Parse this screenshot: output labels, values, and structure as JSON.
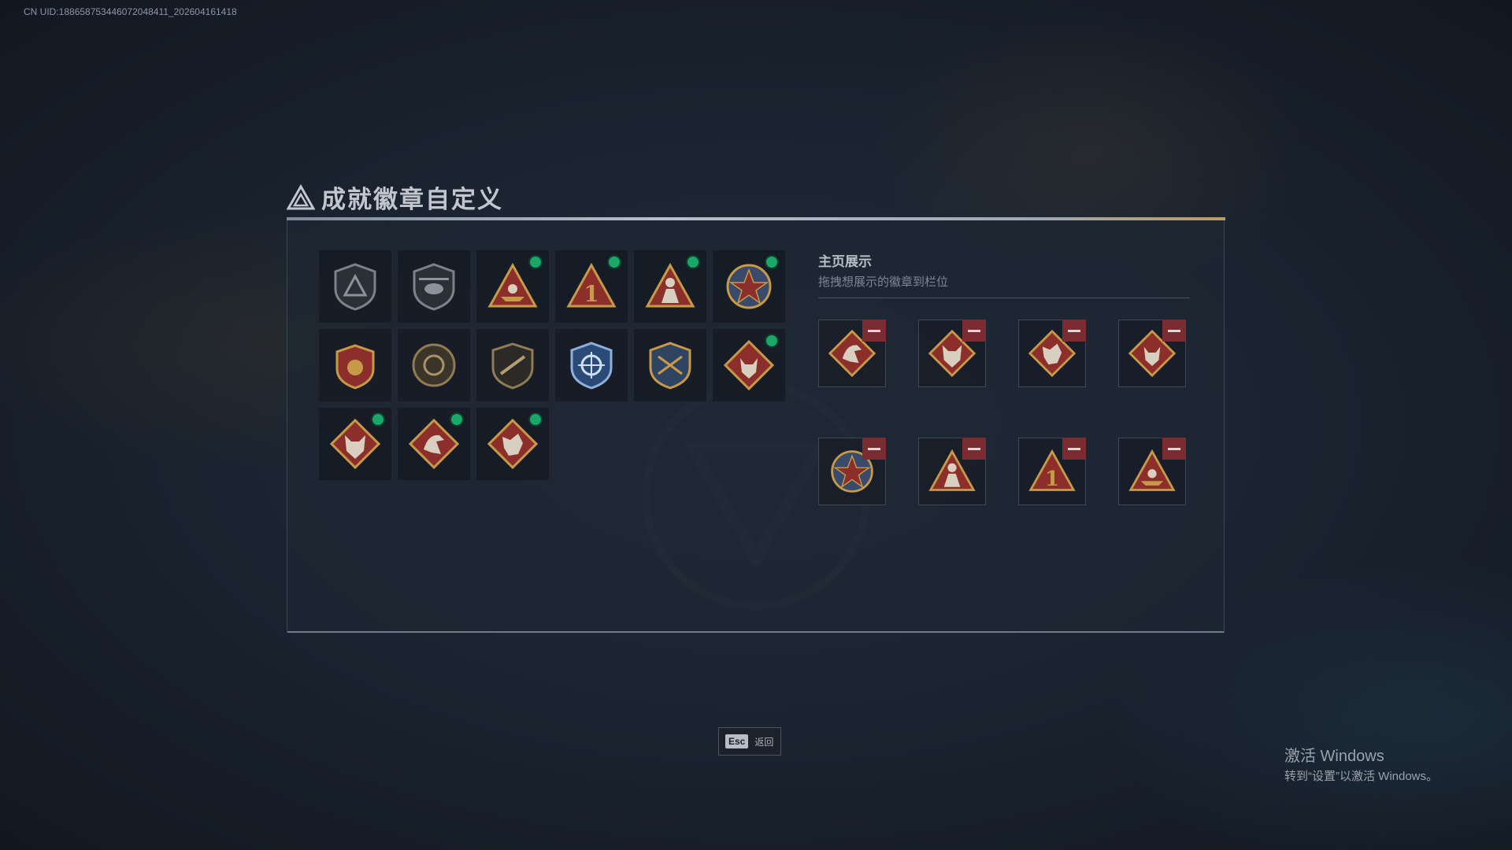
{
  "uid_text": "CN UID:1886587534460720484​11_202604161418",
  "page_title": "成就徽章自定义",
  "badges": [
    {
      "icon": "shield-triangle-badge-icon",
      "new": false
    },
    {
      "icon": "helicopter-badge-icon",
      "new": false
    },
    {
      "icon": "triangle-boat-badge-icon",
      "new": true
    },
    {
      "icon": "triangle-number-one-badge-icon",
      "new": true
    },
    {
      "icon": "triangle-soldier-badge-icon",
      "new": true
    },
    {
      "icon": "star-medal-badge-icon",
      "new": true
    },
    {
      "icon": "gold-shield-badge-icon",
      "new": false
    },
    {
      "icon": "round-emblem-badge-icon",
      "new": false
    },
    {
      "icon": "rifle-shield-badge-icon",
      "new": false
    },
    {
      "icon": "blue-crosshair-badge-icon",
      "new": false
    },
    {
      "icon": "gold-crest-badge-icon",
      "new": false
    },
    {
      "icon": "wolf-diamond-badge-icon",
      "new": true
    },
    {
      "icon": "wolf-head-diamond-badge-icon",
      "new": true
    },
    {
      "icon": "eagle-diamond-badge-icon",
      "new": true
    },
    {
      "icon": "dragon-diamond-badge-icon",
      "new": true
    }
  ],
  "showcase": {
    "title": "主页展示",
    "subtitle": "拖拽想展示的徽章到栏位",
    "slots": [
      {
        "icon": "eagle-diamond-badge-icon"
      },
      {
        "icon": "wolf-head-diamond-badge-icon"
      },
      {
        "icon": "dragon-diamond-badge-icon"
      },
      {
        "icon": "wolf-diamond-badge-icon"
      },
      {
        "icon": "star-medal-badge-icon"
      },
      {
        "icon": "triangle-soldier-badge-icon"
      },
      {
        "icon": "triangle-number-one-badge-icon"
      },
      {
        "icon": "triangle-boat-badge-icon"
      }
    ]
  },
  "esc_key": "Esc",
  "esc_label": "返回",
  "windows_activation": {
    "title": "激活 Windows",
    "subtitle": "转到“设置”以激活 Windows。"
  },
  "colors": {
    "new_dot": "#19a86a",
    "remove_button": "#7a2c30",
    "accent_gold": "#c79a4a"
  }
}
